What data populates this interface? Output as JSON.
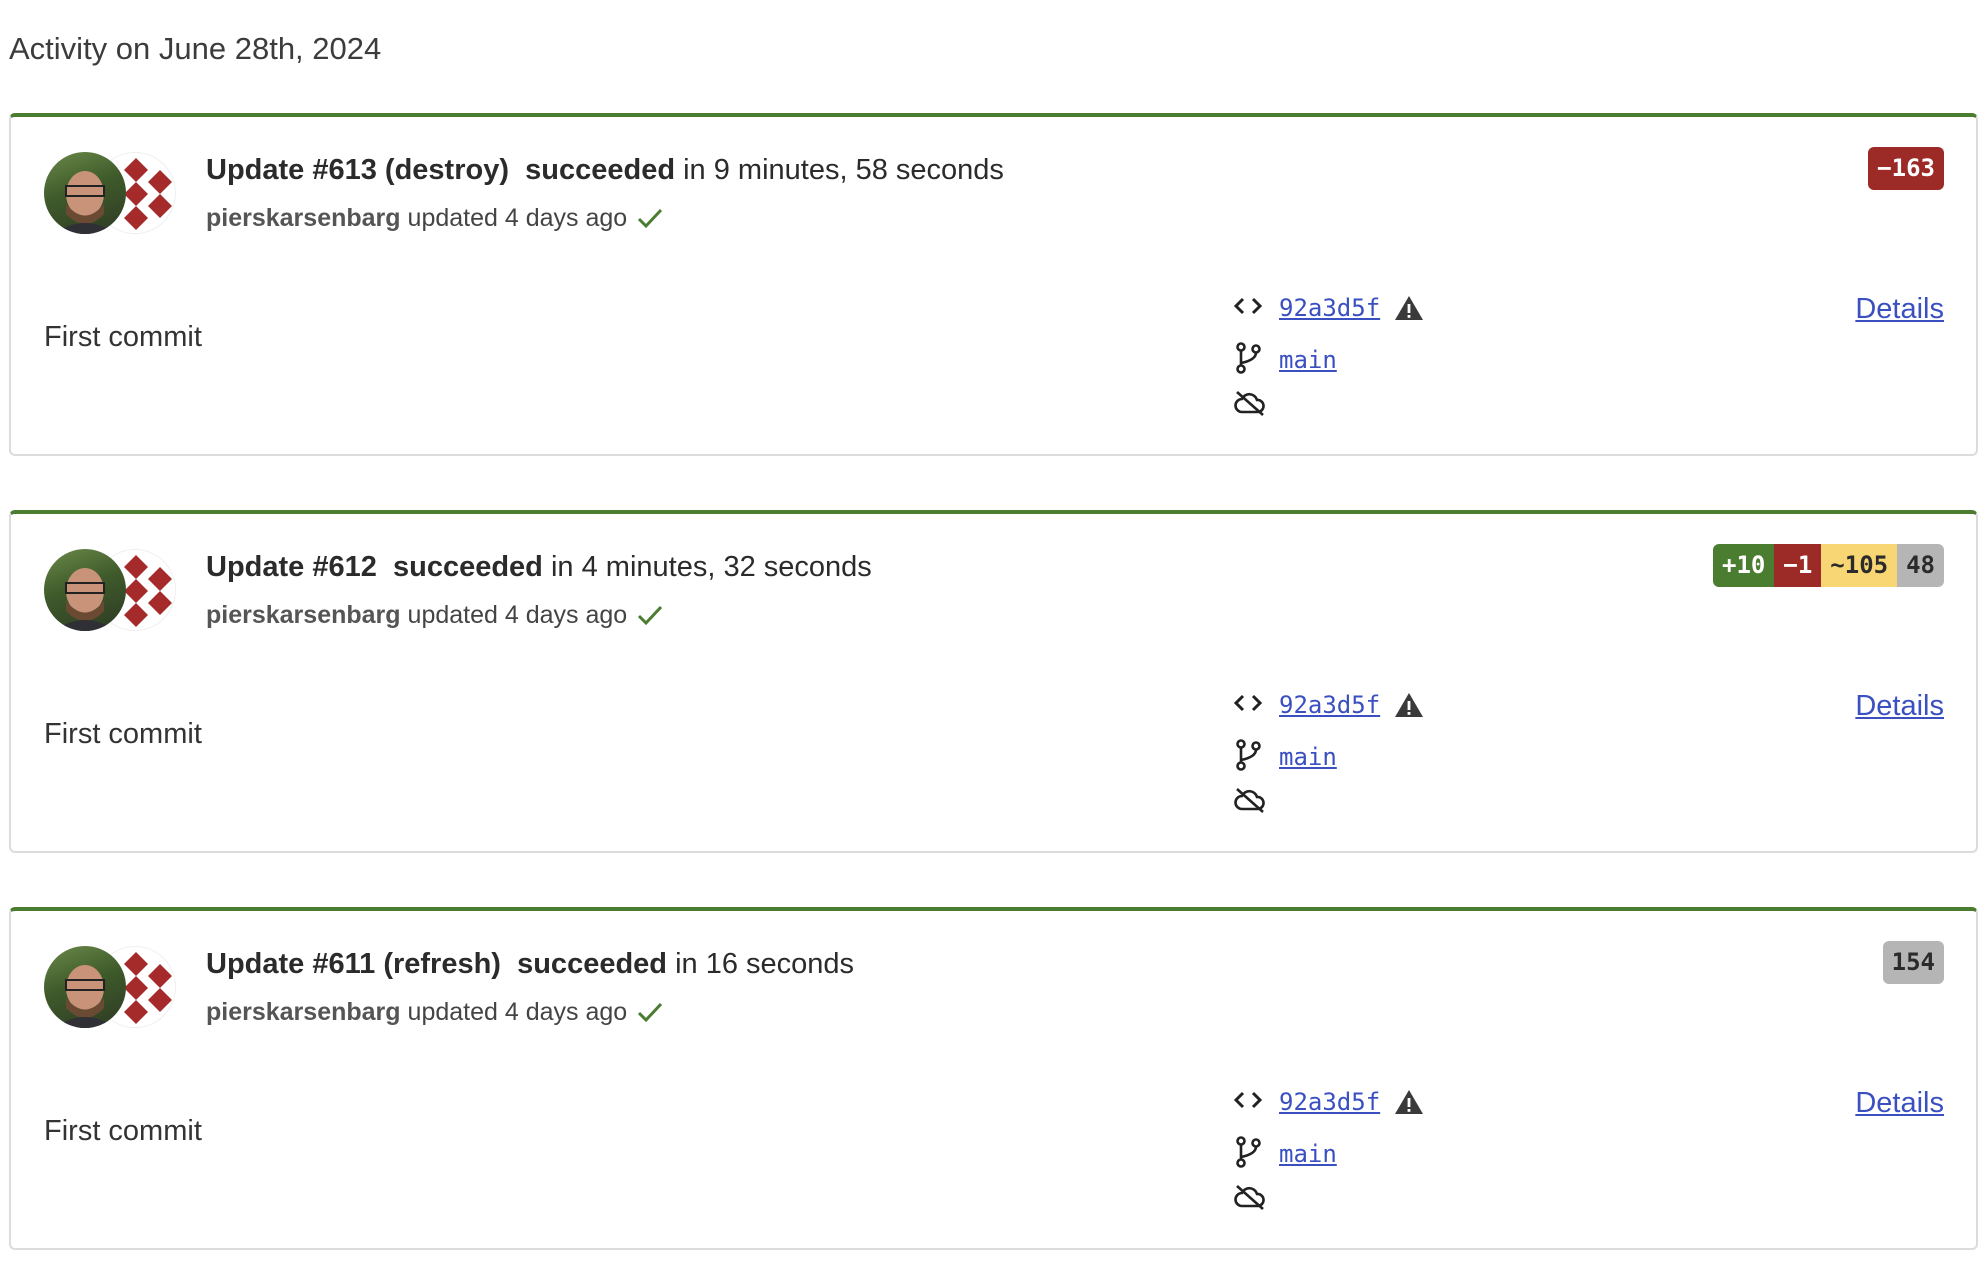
{
  "page": {
    "title": "Activity on June 28th, 2024"
  },
  "updates": [
    {
      "title": "Update #613 (destroy)",
      "status": "succeeded",
      "duration": "in 9 minutes, 58 seconds",
      "user": "pierskarsenbarg",
      "updated_text": "updated 4 days ago",
      "message": "First commit",
      "commit": "92a3d5f",
      "branch": "main",
      "details_label": "Details",
      "badges": [
        {
          "kind": "delete",
          "label": "−163"
        }
      ]
    },
    {
      "title": "Update #612",
      "status": "succeeded",
      "duration": "in 4 minutes, 32 seconds",
      "user": "pierskarsenbarg",
      "updated_text": "updated 4 days ago",
      "message": "First commit",
      "commit": "92a3d5f",
      "branch": "main",
      "details_label": "Details",
      "badges": [
        {
          "kind": "create",
          "label": "+10"
        },
        {
          "kind": "delete",
          "label": "−1"
        },
        {
          "kind": "update",
          "label": "~105"
        },
        {
          "kind": "same",
          "label": "48"
        }
      ]
    },
    {
      "title": "Update #611 (refresh)",
      "status": "succeeded",
      "duration": "in 16 seconds",
      "user": "pierskarsenbarg",
      "updated_text": "updated 4 days ago",
      "message": "First commit",
      "commit": "92a3d5f",
      "branch": "main",
      "details_label": "Details",
      "badges": [
        {
          "kind": "same",
          "label": "154"
        }
      ]
    }
  ],
  "colors": {
    "success": "#4b7d31",
    "delete": "#9c2a26",
    "update": "#f7d673",
    "same": "#b5b5b5",
    "link": "#3a4fc0"
  },
  "icons": [
    "code-icon",
    "warning-icon",
    "git-branch-icon",
    "cloud-off-icon",
    "checkmark-icon",
    "user-avatar",
    "org-avatar"
  ]
}
